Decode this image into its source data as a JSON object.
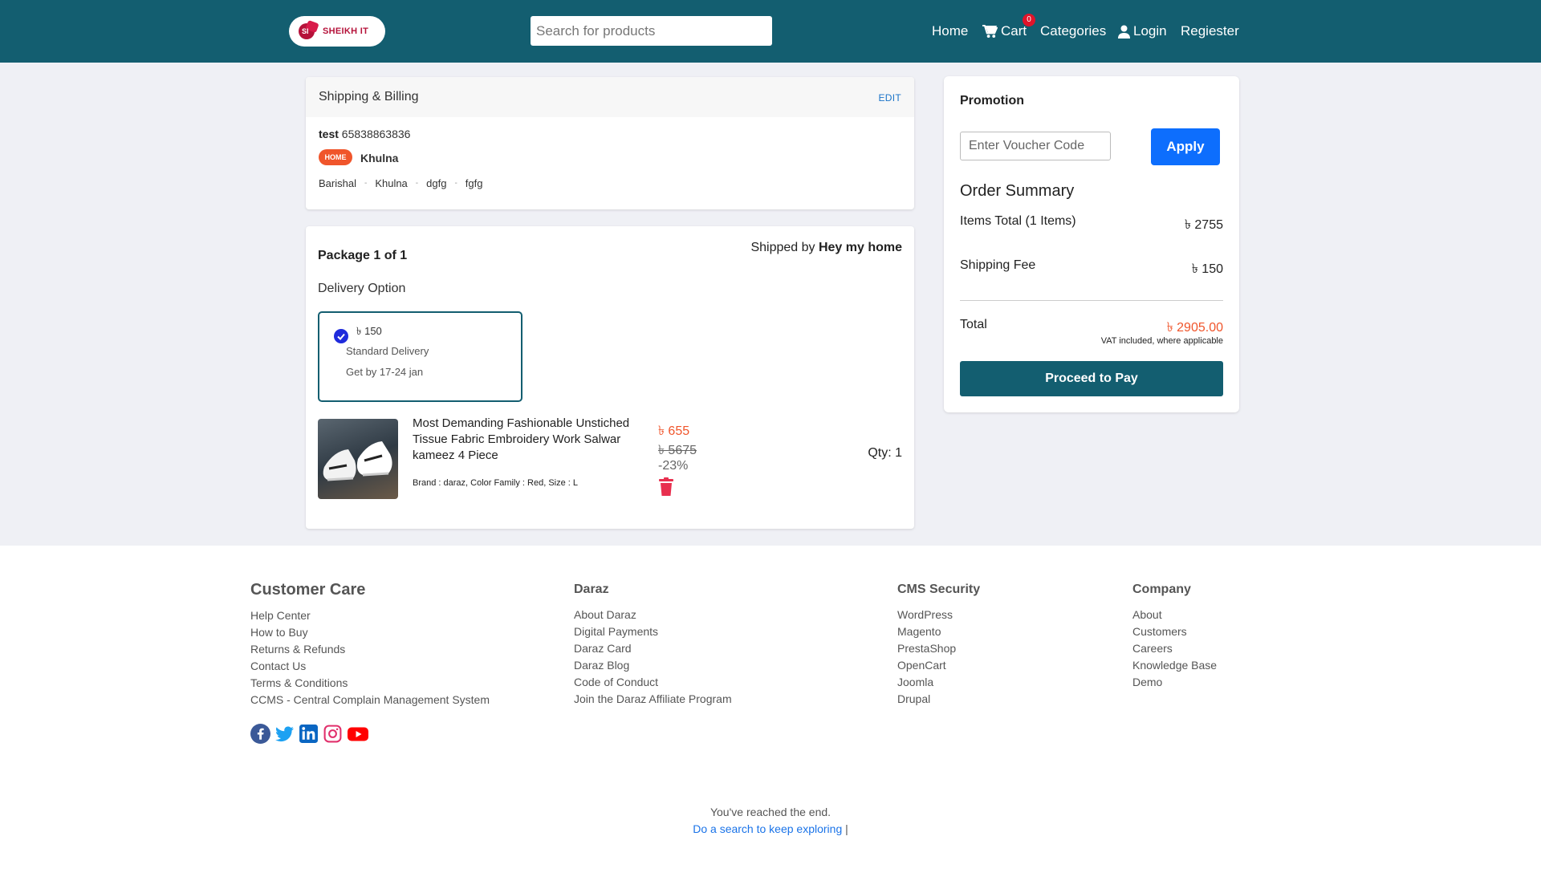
{
  "header": {
    "logo_text": "SHEIKH IT",
    "search_placeholder": "Search for products",
    "nav": {
      "home": "Home",
      "cart": "Cart",
      "cart_count": "0",
      "categories": "Categories",
      "login": "Login",
      "register": "Regiester"
    }
  },
  "shipping": {
    "title": "Shipping & Billing",
    "edit": "EDIT",
    "name": "test",
    "phone": "65838863836",
    "tag": "HOME",
    "city": "Khulna",
    "address": [
      "Barishal",
      "Khulna",
      "dgfg",
      "fgfg"
    ],
    "address_sep": "-"
  },
  "package": {
    "title_pre": "Package ",
    "title_bold": "1 of 1",
    "shipped_by_pre": "Shipped by ",
    "shipped_by": "Hey my home",
    "delivery_label": "Delivery Option",
    "delivery": {
      "price": "৳ 150",
      "name": "Standard Delivery",
      "date": "Get by 17-24 jan"
    },
    "product": {
      "title": "Most Demanding Fashionable Unstiched Tissue Fabric Embroidery Work Salwar kameez 4 Piece",
      "attributes": "Brand : daraz, Color Family : Red, Size : L",
      "price": "৳ 655",
      "old_price": "৳ 5675",
      "discount": "-23%",
      "qty": "Qty: 1"
    }
  },
  "promotion": {
    "title": "Promotion",
    "voucher_placeholder": "Enter Voucher Code",
    "apply": "Apply",
    "summary_title": "Order Summary",
    "items_label": "Items Total (1 Items)",
    "items_value": "৳ 2755",
    "shipping_label": "Shipping Fee",
    "shipping_value": "৳ 150",
    "total_label": "Total",
    "total_value": "৳ 2905.00",
    "vat_note": "VAT included, where applicable",
    "pay_button": "Proceed to Pay"
  },
  "footer": {
    "customer_care": {
      "title": "Customer Care",
      "links": [
        "Help Center",
        "How to Buy",
        "Returns & Refunds",
        "Contact Us",
        "Terms & Conditions",
        "CCMS - Central Complain Management System"
      ]
    },
    "daraz": {
      "title": "Daraz",
      "links": [
        "About Daraz",
        "Digital Payments",
        "Daraz Card",
        "Daraz Blog",
        "Code of Conduct",
        "Join the Daraz Affiliate Program"
      ]
    },
    "cms_security": {
      "title": "CMS Security",
      "links": [
        "WordPress",
        "Magento",
        "PrestaShop",
        "OpenCart",
        "Joomla",
        "Drupal"
      ]
    },
    "company": {
      "title": "Company",
      "links": [
        "About",
        "Customers",
        "Careers",
        "Knowledge Base",
        "Demo"
      ]
    },
    "socials": [
      "facebook-icon",
      "twitter-icon",
      "linkedin-icon",
      "instagram-icon",
      "youtube-icon"
    ],
    "end_text": "You've reached the end.",
    "end_link": "Do a search to keep exploring",
    "end_bar": "|"
  },
  "colors": {
    "header_bg": "#135e70",
    "accent_orange": "#f0552b",
    "apply_blue": "#0d6efd",
    "page_bg": "#eff0f5"
  }
}
